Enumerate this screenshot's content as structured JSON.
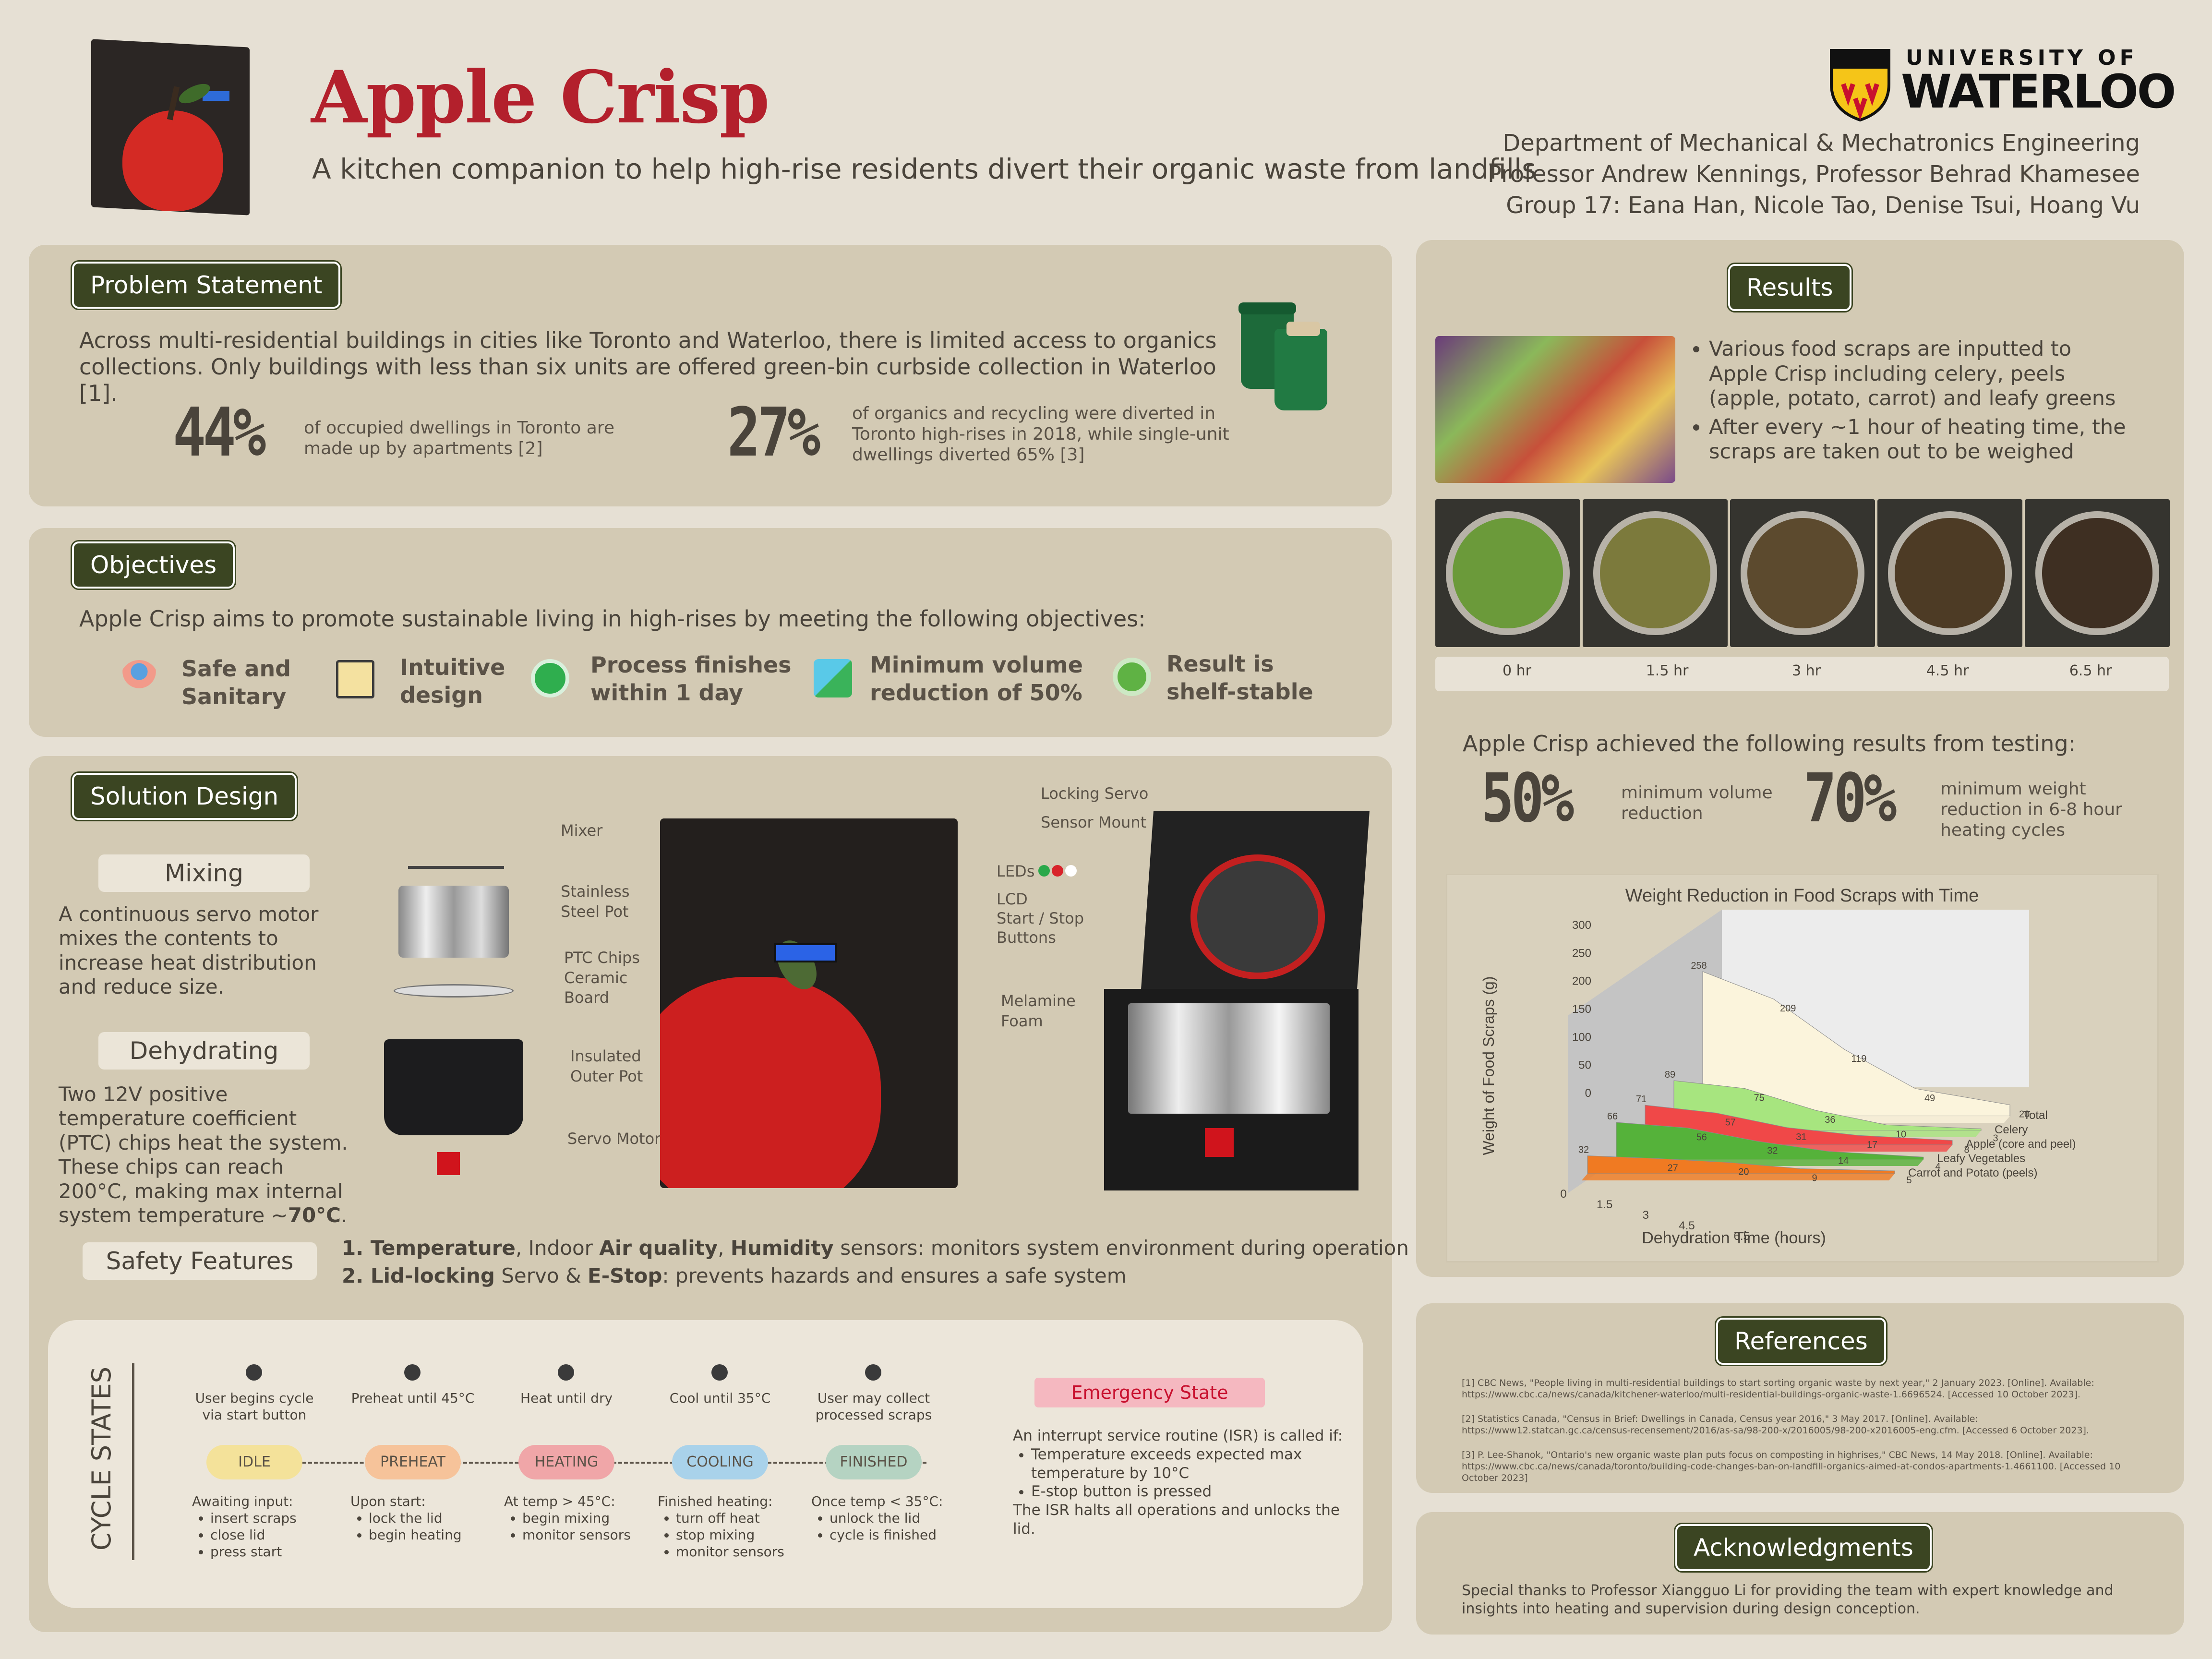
{
  "header": {
    "title": "Apple Crisp",
    "subtitle": "A kitchen companion to help high-rise residents divert their organic waste from landfills",
    "university_top": "UNIVERSITY OF",
    "university_name": "WATERLOO",
    "department": "Department of Mechanical & Mechatronics Engineering",
    "professors": "Professor Andrew Kennings, Professor Behrad Khamesee",
    "group": "Group 17: Eana Han, Nicole Tao, Denise Tsui, Hoang Vu"
  },
  "problem": {
    "heading": "Problem Statement",
    "text": "Across multi-residential buildings in cities like Toronto and Waterloo, there is limited access to organics collections. Only buildings with less than six units are offered green-bin curbside collection in Waterloo [1].",
    "stat1_value": "44%",
    "stat1_text": "of occupied dwellings in Toronto are made up by apartments [2]",
    "stat2_value": "27%",
    "stat2_text": "of organics and recycling were diverted in Toronto high-rises in 2018, while single-unit dwellings diverted 65% [3]"
  },
  "objectives": {
    "heading": "Objectives",
    "intro": "Apple Crisp aims to promote sustainable living in high-rises by meeting the following objectives:",
    "items": [
      {
        "line1": "Safe and",
        "line2": "Sanitary",
        "icon": "person-shield-icon"
      },
      {
        "line1": "Intuitive",
        "line2": "design",
        "icon": "pointer-screen-icon"
      },
      {
        "line1": "Process finishes",
        "line2": "within 1 day",
        "icon": "clock-icon"
      },
      {
        "line1": "Minimum volume",
        "line2": "reduction of 50%",
        "icon": "cube-icon"
      },
      {
        "line1": "Result is",
        "line2": "shelf-stable",
        "icon": "recycle-icon"
      }
    ]
  },
  "solution": {
    "heading": "Solution Design",
    "mixing_heading": "Mixing",
    "mixing_text": "A continuous servo motor mixes the contents to increase heat distribution and reduce size.",
    "dehydrating_heading": "Dehydrating",
    "dehydrating_text_a": "Two 12V positive temperature coefficient (PTC) chips heat the system. These chips can reach 200°C, making max internal system temperature ~",
    "dehydrating_text_b": "70°C",
    "dehydrating_text_c": ".",
    "exploded_labels": {
      "mixer": "Mixer",
      "pot": "Stainless Steel Pot",
      "ptc": "PTC Chips Ceramic Board",
      "outer": "Insulated Outer Pot",
      "servo": "Servo Motor"
    },
    "front_labels": {
      "leds": "LEDs",
      "lcd": "LCD",
      "startstop": "Start / Stop",
      "buttons": "Buttons"
    },
    "open_labels": {
      "locking": "Locking Servo",
      "sensor": "Sensor Mount",
      "melamine1": "Melamine",
      "melamine2": "Foam"
    },
    "safety_heading": "Safety Features",
    "safety1": [
      "1. ",
      "Temperature",
      ", Indoor ",
      "Air quality",
      ", ",
      "Humidity",
      " sensors: monitors system environment during operation"
    ],
    "safety2": [
      "2. ",
      "Lid-locking",
      " Servo & ",
      "E-Stop",
      ": prevents hazards and ensures a safe system"
    ]
  },
  "cycle": {
    "title": "CYCLE STATES",
    "states": [
      {
        "name": "IDLE",
        "top": "User begins cycle via start button",
        "top_icon": "user-icon",
        "desc": "Awaiting input:",
        "bullets": [
          "insert scraps",
          "close lid",
          "press start"
        ],
        "color": "#f4e29a"
      },
      {
        "name": "PREHEAT",
        "top": "Preheat until 45°C",
        "top_icon": "gear-icon",
        "desc": "Upon start:",
        "bullets": [
          "lock the lid",
          "begin heating"
        ],
        "color": "#f6c39a"
      },
      {
        "name": "HEATING",
        "top": "Heat until dry",
        "top_icon": "gear-icon",
        "desc": "At temp > 45°C:",
        "bullets": [
          "begin mixing",
          "monitor sensors"
        ],
        "color": "#f0a6a8"
      },
      {
        "name": "COOLING",
        "top": "Cool until 35°C",
        "top_icon": "gear-icon",
        "desc": "Finished heating:",
        "bullets": [
          "turn off heat",
          "stop mixing",
          "monitor sensors"
        ],
        "color": "#a9d2ea"
      },
      {
        "name": "FINISHED",
        "top": "User may collect processed scraps",
        "top_icon": "user-icon",
        "desc": "Once temp < 35°C:",
        "bullets": [
          "unlock the lid",
          "cycle is finished"
        ],
        "color": "#b5d3c2"
      }
    ],
    "emergency_title": "Emergency State",
    "emergency_intro": "An interrupt service routine (ISR) is called if:",
    "emergency_bullets": [
      "Temperature exceeds expected max temperature by 10°C",
      "E-stop button is pressed"
    ],
    "emergency_outro": "The ISR halts all operations and unlocks the lid."
  },
  "results": {
    "heading": "Results",
    "bullets": [
      "Various food scraps are inputted to Apple Crisp including celery, peels (apple, potato, carrot) and leafy greens",
      "After  every ~1 hour of heating time, the scraps are taken out to be weighed"
    ],
    "timeline": [
      "0 hr",
      "1.5 hr",
      "3 hr",
      "4.5 hr",
      "6.5 hr"
    ],
    "summary": "Apple Crisp achieved the following results from testing:",
    "stat1_value": "50%",
    "stat1_text": "minimum volume reduction",
    "stat2_value": "70%",
    "stat2_text": "minimum weight reduction in 6-8 hour heating cycles"
  },
  "chart_data": {
    "type": "area",
    "title": "Weight Reduction in Food Scraps with Time",
    "xlabel": "Dehydration Time (hours)",
    "ylabel": "Weight of Food Scraps (g)",
    "x": [
      0,
      1.5,
      3,
      4.5,
      6.5
    ],
    "x_ticks": [
      "0",
      "1.5",
      "3",
      "4.5",
      "6.5"
    ],
    "y_ticks": [
      "0",
      "50",
      "100",
      "150",
      "200",
      "250",
      "300"
    ],
    "ylim": [
      0,
      300
    ],
    "series": [
      {
        "name": "Total",
        "values": [
          258,
          209,
          119,
          49,
          20
        ],
        "color": "#fbf4dc"
      },
      {
        "name": "Celery",
        "values": [
          89,
          75,
          36,
          10,
          3
        ],
        "color": "#a7e57f"
      },
      {
        "name": "Apple (core and peel)",
        "values": [
          71,
          57,
          31,
          17,
          8
        ],
        "color": "#f04848"
      },
      {
        "name": "Leafy Vegetables",
        "values": [
          66,
          56,
          32,
          14,
          4
        ],
        "color": "#55b23a"
      },
      {
        "name": "Carrot and Potato (peels)",
        "values": [
          32,
          27,
          20,
          9,
          5
        ],
        "color": "#f07a22"
      }
    ]
  },
  "references": {
    "heading": "References",
    "items": [
      "[1] CBC News, \"People living in multi-residential buildings to start sorting organic waste by next year,\" 2 January 2023. [Online]. Available: https://www.cbc.ca/news/canada/kitchener-waterloo/multi-residential-buildings-organic-waste-1.6696524. [Accessed 10 October 2023].",
      "[2] Statistics Canada, \"Census in Brief: Dwellings in Canada, Census year 2016,\" 3 May 2017. [Online]. Available: https://www12.statcan.gc.ca/census-recensement/2016/as-sa/98-200-x/2016005/98-200-x2016005-eng.cfm. [Accessed 6 October 2023].",
      "[3] P. Lee-Shanok, \"Ontario's new organic waste plan puts focus on composting in highrises,\" CBC News, 14 May 2018. [Online]. Available: https://www.cbc.ca/news/canada/toronto/building-code-changes-ban-on-landfill-organics-aimed-at-condos-apartments-1.4661100. [Accessed 10 October 2023]"
    ]
  },
  "ack": {
    "heading": "Acknowledgments",
    "text": "Special thanks to Professor Xiangguo Li for providing the team with expert knowledge and insights into heating and supervision during design conception."
  },
  "colors": {
    "accent_green": "#3b4522",
    "title_red": "#b3202c",
    "panel": "#d3cab4",
    "background": "#e6e0d4"
  }
}
